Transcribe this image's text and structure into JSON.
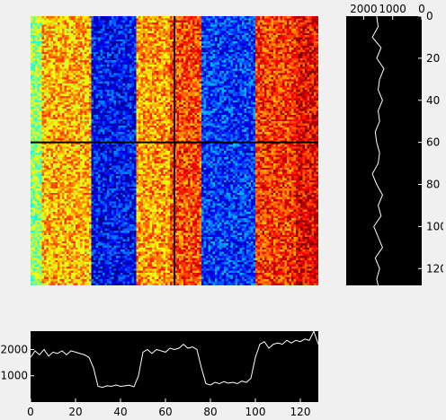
{
  "chart_data": [
    {
      "type": "heatmap",
      "colormap": "jet",
      "rows": 128,
      "cols": 128,
      "crosshair": {
        "x": 64,
        "y": 60
      },
      "grid": false,
      "stripes": [
        {
          "from": 0,
          "to": 5,
          "value": 1600
        },
        {
          "from": 5,
          "to": 27,
          "value": 2000
        },
        {
          "from": 27,
          "to": 47,
          "value": 700
        },
        {
          "from": 47,
          "to": 62,
          "value": 2050
        },
        {
          "from": 62,
          "to": 76,
          "value": 2250
        },
        {
          "from": 76,
          "to": 100,
          "value": 800
        },
        {
          "from": 100,
          "to": 118,
          "value": 2300
        },
        {
          "from": 118,
          "to": 128,
          "value": 2450
        }
      ],
      "color_range": [
        400,
        2700
      ]
    },
    {
      "type": "line",
      "orientation": "vertical",
      "xticks": [
        2000,
        1000,
        0
      ],
      "yticks": [
        0,
        20,
        40,
        60,
        80,
        100,
        120
      ],
      "xlim": [
        0,
        2600
      ],
      "ylim": [
        0,
        128
      ],
      "y": [
        0,
        5,
        10,
        15,
        20,
        25,
        30,
        35,
        40,
        45,
        50,
        55,
        60,
        65,
        70,
        75,
        80,
        85,
        90,
        95,
        100,
        105,
        110,
        115,
        120,
        125,
        128
      ],
      "values": [
        1550,
        1500,
        1700,
        1400,
        1550,
        1300,
        1450,
        1500,
        1350,
        1500,
        1450,
        1600,
        1550,
        1450,
        1500,
        1700,
        1550,
        1350,
        1500,
        1400,
        1650,
        1500,
        1350,
        1600,
        1450,
        1550,
        1500
      ]
    },
    {
      "type": "line",
      "xticks": [
        0,
        20,
        40,
        60,
        80,
        100,
        120
      ],
      "yticks": [
        1000,
        2000
      ],
      "xlim": [
        0,
        128
      ],
      "ylim": [
        0,
        2700
      ],
      "x": [
        0,
        2,
        4,
        6,
        8,
        10,
        12,
        14,
        16,
        18,
        20,
        22,
        24,
        26,
        28,
        30,
        32,
        34,
        36,
        38,
        40,
        42,
        44,
        46,
        48,
        50,
        52,
        54,
        56,
        58,
        60,
        62,
        64,
        66,
        68,
        70,
        72,
        74,
        76,
        78,
        80,
        82,
        84,
        86,
        88,
        90,
        92,
        94,
        96,
        98,
        100,
        102,
        104,
        106,
        108,
        110,
        112,
        114,
        116,
        118,
        120,
        122,
        124,
        126,
        128
      ],
      "values": [
        1700,
        1950,
        1800,
        2000,
        1750,
        1900,
        1850,
        1950,
        1800,
        1950,
        1900,
        1850,
        1800,
        1700,
        1300,
        600,
        560,
        620,
        600,
        650,
        600,
        620,
        640,
        580,
        1000,
        1900,
        2000,
        1850,
        2000,
        1950,
        1900,
        2050,
        2000,
        2050,
        2200,
        2050,
        2100,
        2000,
        1300,
        700,
        650,
        750,
        700,
        780,
        720,
        750,
        700,
        800,
        750,
        900,
        1700,
        2200,
        2300,
        2050,
        2200,
        2250,
        2200,
        2350,
        2250,
        2350,
        2300,
        2400,
        2350,
        2700,
        2200
      ]
    }
  ]
}
